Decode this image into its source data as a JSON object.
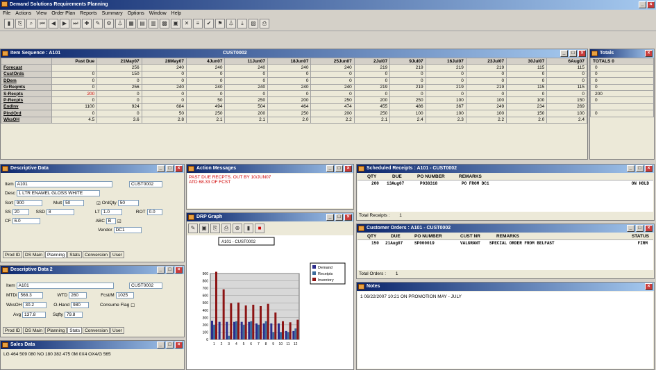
{
  "app": {
    "title": "Demand Solutions Requirements Planning"
  },
  "menu": [
    "File",
    "Actions",
    "View",
    "Order Plan",
    "Reports",
    "Summary",
    "Options",
    "Window",
    "Help"
  ],
  "toolbar_icons": [
    "open-icon",
    "print-icon",
    "binoculars-icon",
    "first-icon",
    "prev-icon",
    "next-icon",
    "last-icon",
    "add-icon",
    "chart-icon",
    "settings-icon",
    "filter-icon",
    "calc-icon",
    "grid-icon",
    "table-icon",
    "chart2-icon",
    "calendar-icon",
    "close-icon",
    "lines-icon",
    "check-icon",
    "flag-icon",
    "filter2-icon",
    "export-icon",
    "image-icon",
    "print2-icon"
  ],
  "item_seq": {
    "title": "Item Sequence : A101",
    "customer": "CUST0002",
    "columns": [
      "",
      "Past Due",
      "21May07",
      "28May07",
      "4Jun07",
      "11Jun07",
      "18Jun07",
      "25Jun07",
      "2Jul07",
      "9Jul07",
      "16Jul07",
      "23Jul07",
      "30Jul07",
      "6Aug07"
    ],
    "rows": [
      {
        "label": "Forecast",
        "values": [
          "",
          "256",
          "240",
          "240",
          "240",
          "240",
          "240",
          "219",
          "219",
          "219",
          "219",
          "115",
          "115"
        ]
      },
      {
        "label": "CustOrds",
        "values": [
          "0",
          "150",
          "0",
          "0",
          "0",
          "0",
          "0",
          "0",
          "0",
          "0",
          "0",
          "0",
          "0"
        ]
      },
      {
        "label": "DDem",
        "values": [
          "0",
          "0",
          "0",
          "0",
          "0",
          "0",
          "0",
          "0",
          "0",
          "0",
          "0",
          "0",
          "0"
        ]
      },
      {
        "label": "GrReqmts",
        "values": [
          "0",
          "256",
          "240",
          "240",
          "240",
          "240",
          "240",
          "219",
          "219",
          "219",
          "219",
          "115",
          "115"
        ]
      },
      {
        "label": "S-Recpts",
        "values": [
          "200",
          "0",
          "0",
          "0",
          "0",
          "0",
          "0",
          "0",
          "0",
          "0",
          "0",
          "0",
          "0"
        ]
      },
      {
        "label": "P-Recpts",
        "values": [
          "0",
          "0",
          "0",
          "50",
          "250",
          "200",
          "250",
          "200",
          "250",
          "100",
          "100",
          "100",
          "150"
        ]
      },
      {
        "label": "EndInv",
        "values": [
          "1100",
          "924",
          "684",
          "494",
          "504",
          "464",
          "474",
          "455",
          "486",
          "367",
          "249",
          "234",
          "269"
        ]
      },
      {
        "label": "PlndOrd",
        "values": [
          "0",
          "0",
          "50",
          "250",
          "200",
          "250",
          "200",
          "250",
          "100",
          "100",
          "100",
          "150",
          "100"
        ]
      },
      {
        "label": "WksOH",
        "values": [
          "4.5",
          "3.6",
          "2.8",
          "2.1",
          "2.1",
          "2.0",
          "2.2",
          "2.1",
          "2.4",
          "2.3",
          "2.2",
          "2.0",
          "2.4"
        ]
      }
    ]
  },
  "totals": {
    "title": "Totals",
    "header": "TOTALS 0",
    "values": [
      "0",
      "0",
      "0",
      "0",
      "200",
      "0",
      "",
      "0"
    ]
  },
  "desc1": {
    "title": "Descriptive Data",
    "item": "A101",
    "cust": "CUST0002",
    "desc": "1 LTR ENAMEL GLOSS WHITE",
    "sort": "900",
    "mult": "50",
    "ordqty": "50",
    "ss": "20",
    "ssd": "8",
    "lt": "1.0",
    "rot": "0.0",
    "cf": "6.0",
    "abc": "B",
    "vendor": "DC1",
    "lbl_item": "Item",
    "lbl_desc": "Desc",
    "lbl_sort": "Sort",
    "lbl_mult": "Mult",
    "lbl_ordqty": "OrdQty",
    "lbl_ss": "SS",
    "lbl_ssd": "SSD",
    "lbl_lt": "LT",
    "lbl_rot": "ROT",
    "lbl_cf": "CF",
    "lbl_abc": "ABC",
    "lbl_vendor": "Vendor",
    "tabs": [
      "Prod ID",
      "DS Main",
      "Planning",
      "Stats",
      "Conversion",
      "User"
    ]
  },
  "desc2": {
    "title": "Descriptive Data 2",
    "item": "A101",
    "cust": "CUST0002",
    "mtd": "568.3",
    "wtd": "260",
    "fcst": "1025",
    "wks": "30.2",
    "onhand": "980",
    "avg": "137.8",
    "safety": "79.8",
    "lbl_item": "Item",
    "lbl_mtd": "MTDi",
    "lbl_wtd": "WTD",
    "lbl_fcst": "Fcst/M",
    "lbl_wks": "WksOH",
    "lbl_onhand": "O-Hand",
    "lbl_consume": "Consume Flag",
    "lbl_avg": "Avg",
    "lbl_safety": "Sqfty",
    "tabs": [
      "Prod ID",
      "DS Main",
      "Planning",
      "Stats",
      "Conversion",
      "User"
    ]
  },
  "sales": {
    "title": "Sales Data",
    "line": "LG 464 509 080 NO 180 382 475 0M 0X4 OX4/G 565"
  },
  "action": {
    "title": "Action Messages",
    "msg1": "PAST DUE RECPTS. OUT BY 10/JUN07",
    "msg2": "ATD 68.33 OF FCST"
  },
  "graph": {
    "title": "DRP Graph",
    "dropdown": "A101 - CUST0002",
    "legend": [
      {
        "name": "Demand",
        "color": "#2c2c8c"
      },
      {
        "name": "Receipts",
        "color": "#3c6c9c"
      },
      {
        "name": "Inventory",
        "color": "#8c1414"
      }
    ],
    "yticks": [
      "900",
      "800",
      "700",
      "600",
      "500",
      "400",
      "300",
      "200",
      "100",
      "0"
    ],
    "xticks": [
      "1",
      "2",
      "3",
      "4",
      "5",
      "6",
      "7",
      "8",
      "9",
      "10",
      "11",
      "12"
    ]
  },
  "chart_data": {
    "type": "bar",
    "categories": [
      "1",
      "2",
      "3",
      "4",
      "5",
      "6",
      "7",
      "8",
      "9",
      "10",
      "11",
      "12"
    ],
    "series": [
      {
        "name": "Demand",
        "values": [
          256,
          240,
          240,
          240,
          240,
          240,
          219,
          219,
          219,
          219,
          115,
          115
        ]
      },
      {
        "name": "Receipts",
        "values": [
          200,
          0,
          50,
          250,
          200,
          250,
          200,
          250,
          100,
          100,
          100,
          150
        ]
      },
      {
        "name": "Inventory",
        "values": [
          924,
          684,
          494,
          504,
          464,
          474,
          455,
          486,
          367,
          249,
          234,
          269
        ]
      }
    ],
    "ylim": [
      0,
      900
    ]
  },
  "sched": {
    "title": "Scheduled Receipts : A101 - CUST0002",
    "cols": [
      "QTY",
      "DUE",
      "PO NUMBER",
      "REMARKS"
    ],
    "row": [
      "200",
      "13Aug07",
      "P038318",
      "PO FROM DC1",
      "ON HOLD"
    ],
    "total_label": "Total Receipts :",
    "total": "1"
  },
  "custord": {
    "title": "Customer Orders : A101 - CUST0002",
    "cols": [
      "QTY",
      "DUE",
      "PO NUMBER",
      "CUST NR",
      "REMARKS",
      "STATUS"
    ],
    "row": [
      "150",
      "21Aug07",
      "SP000019",
      "VALGRANT",
      "SPECIAL ORDER FROM BELFAST",
      "FIRM"
    ],
    "total_label": "Total Orders :",
    "total": "1"
  },
  "notes": {
    "title": "Notes",
    "line": "1   06/22/2007 10:21 ON PROMOTION MAY - JULY"
  }
}
